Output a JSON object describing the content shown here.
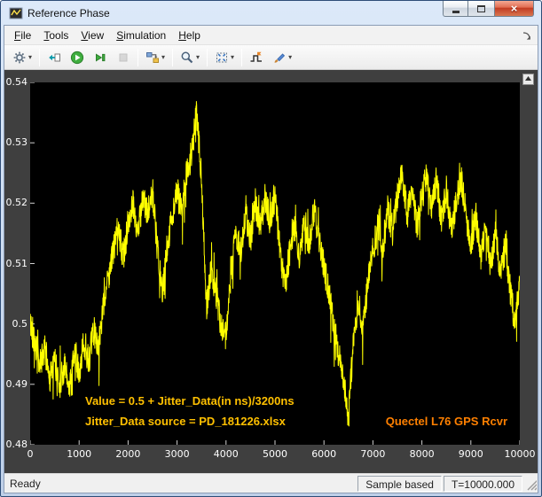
{
  "window": {
    "title": "Reference Phase",
    "controls": {
      "minimize": "minimize",
      "maximize": "maximize",
      "close_glyph": "×"
    }
  },
  "menu": {
    "items": [
      "File",
      "Tools",
      "View",
      "Simulation",
      "Help"
    ]
  },
  "toolbar": {
    "buttons": [
      {
        "name": "parameters",
        "icon": "gear",
        "dropdown": true
      },
      {
        "type": "separator"
      },
      {
        "name": "highlight-block",
        "icon": "highlight-block"
      },
      {
        "name": "run",
        "icon": "run"
      },
      {
        "name": "step-forward",
        "icon": "step-forward"
      },
      {
        "name": "stop",
        "icon": "stop",
        "disabled": true
      },
      {
        "type": "separator"
      },
      {
        "name": "step-options",
        "icon": "step-options",
        "dropdown": true
      },
      {
        "type": "separator"
      },
      {
        "name": "zoom",
        "icon": "zoom",
        "dropdown": true
      },
      {
        "type": "separator"
      },
      {
        "name": "fit-to-view",
        "icon": "fit",
        "dropdown": true
      },
      {
        "type": "separator"
      },
      {
        "name": "trigger",
        "icon": "trigger"
      },
      {
        "name": "style",
        "icon": "brush",
        "dropdown": true
      }
    ]
  },
  "scope": {
    "annotations": {
      "line1": "Value = 0.5 + Jitter_Data(in ns)/3200ns",
      "line2": "Jitter_Data source = PD_181226.xlsx",
      "right": "Quectel L76 GPS Rcvr"
    },
    "colors": {
      "trace": "#ffff00",
      "annotation_left": "#ffc000",
      "annotation_right": "#ff8000",
      "plot_bg": "#000000",
      "frame_bg": "#3f3f3f",
      "tick_text": "#ffffff"
    }
  },
  "status_bar": {
    "left": "Ready",
    "sample_mode": "Sample based",
    "time": "T=10000.000"
  },
  "chart_data": {
    "type": "line",
    "title": "",
    "xlabel": "",
    "ylabel": "",
    "xlim": [
      0,
      10000
    ],
    "ylim": [
      0.48,
      0.54
    ],
    "grid": false,
    "legend": false,
    "xticks": [
      {
        "value": 0,
        "label": "0"
      },
      {
        "value": 1000,
        "label": "1000"
      },
      {
        "value": 2000,
        "label": "2000"
      },
      {
        "value": 3000,
        "label": "3000"
      },
      {
        "value": 4000,
        "label": "4000"
      },
      {
        "value": 5000,
        "label": "5000"
      },
      {
        "value": 6000,
        "label": "6000"
      },
      {
        "value": 7000,
        "label": "7000"
      },
      {
        "value": 8000,
        "label": "8000"
      },
      {
        "value": 9000,
        "label": "9000"
      },
      {
        "value": 10000,
        "label": "10000"
      }
    ],
    "yticks": [
      {
        "value": 0.54,
        "label": "0.54"
      },
      {
        "value": 0.53,
        "label": "0.53"
      },
      {
        "value": 0.52,
        "label": "0.52"
      },
      {
        "value": 0.51,
        "label": "0.51"
      },
      {
        "value": 0.5,
        "label": "0.5"
      },
      {
        "value": 0.49,
        "label": "0.49"
      },
      {
        "value": 0.48,
        "label": "0.48"
      }
    ],
    "jitter": {
      "seed": 42,
      "step": 5,
      "amplitude": 0.0025,
      "spike_probability": 0.08,
      "spike_amplitude": 0.005
    },
    "series": [
      {
        "name": "Reference Phase",
        "color": "#ffff00",
        "x": [
          0,
          100,
          200,
          300,
          400,
          500,
          600,
          700,
          800,
          900,
          1000,
          1100,
          1200,
          1300,
          1400,
          1500,
          1600,
          1700,
          1800,
          1900,
          2000,
          2100,
          2200,
          2300,
          2400,
          2500,
          2600,
          2700,
          2800,
          2900,
          3000,
          3100,
          3200,
          3300,
          3400,
          3500,
          3600,
          3700,
          3800,
          3900,
          4000,
          4100,
          4200,
          4300,
          4400,
          4500,
          4600,
          4700,
          4800,
          4900,
          5000,
          5100,
          5200,
          5300,
          5400,
          5500,
          5600,
          5700,
          5800,
          5900,
          6000,
          6100,
          6200,
          6300,
          6400,
          6500,
          6600,
          6700,
          6800,
          6900,
          7000,
          7100,
          7200,
          7300,
          7400,
          7500,
          7600,
          7700,
          7800,
          7900,
          8000,
          8100,
          8200,
          8300,
          8400,
          8500,
          8600,
          8700,
          8800,
          8900,
          9000,
          9100,
          9200,
          9300,
          9400,
          9500,
          9600,
          9700,
          9800,
          9900,
          10000
        ],
        "y": [
          0.5,
          0.497,
          0.493,
          0.496,
          0.491,
          0.494,
          0.49,
          0.493,
          0.489,
          0.495,
          0.492,
          0.497,
          0.494,
          0.499,
          0.496,
          0.503,
          0.508,
          0.512,
          0.516,
          0.511,
          0.517,
          0.52,
          0.515,
          0.521,
          0.518,
          0.522,
          0.512,
          0.505,
          0.513,
          0.518,
          0.522,
          0.519,
          0.525,
          0.528,
          0.535,
          0.524,
          0.503,
          0.509,
          0.505,
          0.5,
          0.498,
          0.508,
          0.515,
          0.512,
          0.518,
          0.514,
          0.52,
          0.516,
          0.521,
          0.517,
          0.522,
          0.512,
          0.506,
          0.512,
          0.516,
          0.511,
          0.517,
          0.513,
          0.519,
          0.514,
          0.51,
          0.505,
          0.5,
          0.495,
          0.49,
          0.485,
          0.497,
          0.503,
          0.499,
          0.507,
          0.512,
          0.516,
          0.512,
          0.519,
          0.515,
          0.521,
          0.525,
          0.518,
          0.523,
          0.516,
          0.521,
          0.525,
          0.519,
          0.524,
          0.517,
          0.522,
          0.515,
          0.52,
          0.524,
          0.518,
          0.513,
          0.518,
          0.511,
          0.516,
          0.51,
          0.515,
          0.508,
          0.513,
          0.506,
          0.5,
          0.507
        ]
      }
    ]
  }
}
